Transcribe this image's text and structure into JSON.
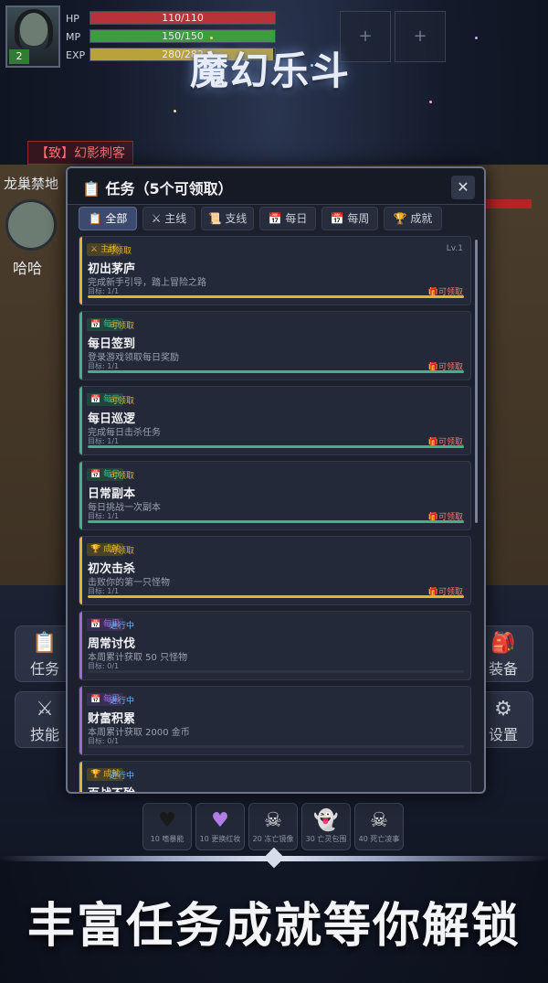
{
  "player": {
    "level": "2",
    "hp_label": "HP",
    "hp_text": "110/110",
    "hp_fraction": 1.0,
    "mp_label": "MP",
    "mp_text": "150/150",
    "mp_fraction": 1.0,
    "exp_label": "EXP",
    "exp_text": "280/282",
    "exp_fraction": 0.99,
    "name": "哈哈"
  },
  "colors": {
    "hp": "#b8323a",
    "mp": "#3f9b3f",
    "exp": "#b8a23a"
  },
  "hud": {
    "slot1": "+",
    "slot2": "+"
  },
  "game_title": "魔幻乐斗",
  "scene": {
    "enemy_tag": "【致】幻影刺客",
    "zone_name": "龙巢禁地"
  },
  "side_menu": {
    "quest": {
      "label": "任务",
      "icon": "clipboard-icon"
    },
    "skill": {
      "label": "技能",
      "icon": "crossed-swords-icon"
    },
    "equip": {
      "label": "装备",
      "icon": "backpack-icon"
    },
    "settings": {
      "label": "设置",
      "icon": "gear-icon"
    }
  },
  "skills": [
    {
      "icon": "heart-icon",
      "label": "10 嗜暴能"
    },
    {
      "icon": "purple-heart-icon",
      "label": "10 更换红妆"
    },
    {
      "icon": "skull-icon",
      "label": "20 冻亡镜像"
    },
    {
      "icon": "ghost-icon",
      "label": "30 亡灵包围"
    },
    {
      "icon": "skull-crossbones-icon",
      "label": "40 死亡凌事"
    }
  ],
  "panel": {
    "title": "任务（5个可领取）",
    "close": "✕",
    "tabs": [
      "全部",
      "主线",
      "支线",
      "每日",
      "每周",
      "成就"
    ],
    "active_tab": "全部"
  },
  "quests": [
    {
      "tag": "主线",
      "state": "可领取",
      "level": "Lv.1",
      "name": "初出茅庐",
      "desc": "完成新手引导，踏上冒险之路",
      "goal": "目标: 1/1",
      "claim": "可领取",
      "progress": 1.0,
      "color": "#e3b52c"
    },
    {
      "tag": "每日",
      "state": "可领取",
      "level": "",
      "name": "每日签到",
      "desc": "登录游戏领取每日奖励",
      "goal": "目标: 1/1",
      "claim": "可领取",
      "progress": 1.0,
      "color": "#3fb28a"
    },
    {
      "tag": "每日",
      "state": "可领取",
      "level": "",
      "name": "每日巡逻",
      "desc": "完成每日击杀任务",
      "goal": "目标: 1/1",
      "claim": "可领取",
      "progress": 1.0,
      "color": "#3fb28a"
    },
    {
      "tag": "每日",
      "state": "可领取",
      "level": "",
      "name": "日常副本",
      "desc": "每日挑战一次副本",
      "goal": "目标: 1/1",
      "claim": "可领取",
      "progress": 1.0,
      "color": "#3fb28a"
    },
    {
      "tag": "成就",
      "state": "可领取",
      "level": "",
      "name": "初次击杀",
      "desc": "击败你的第一只怪物",
      "goal": "目标: 1/1",
      "claim": "可领取",
      "progress": 1.0,
      "color": "#e3b52c"
    },
    {
      "tag": "每周",
      "state": "进行中",
      "level": "",
      "name": "周常讨伐",
      "desc": "本周累计获取 50 只怪物",
      "goal": "目标: 0/1",
      "claim": "",
      "progress": 0.0,
      "color": "#9b6bd9"
    },
    {
      "tag": "每周",
      "state": "进行中",
      "level": "",
      "name": "财富积累",
      "desc": "本周累计获取 2000 金币",
      "goal": "目标: 0/1",
      "claim": "",
      "progress": 0.0,
      "color": "#9b6bd9"
    },
    {
      "tag": "成就",
      "state": "进行中",
      "level": "",
      "name": "百战不殆",
      "desc": "",
      "goal": "",
      "claim": "",
      "progress": 0.0,
      "color": "#e3b52c"
    }
  ],
  "promo_text": "丰富任务成就等你解锁"
}
